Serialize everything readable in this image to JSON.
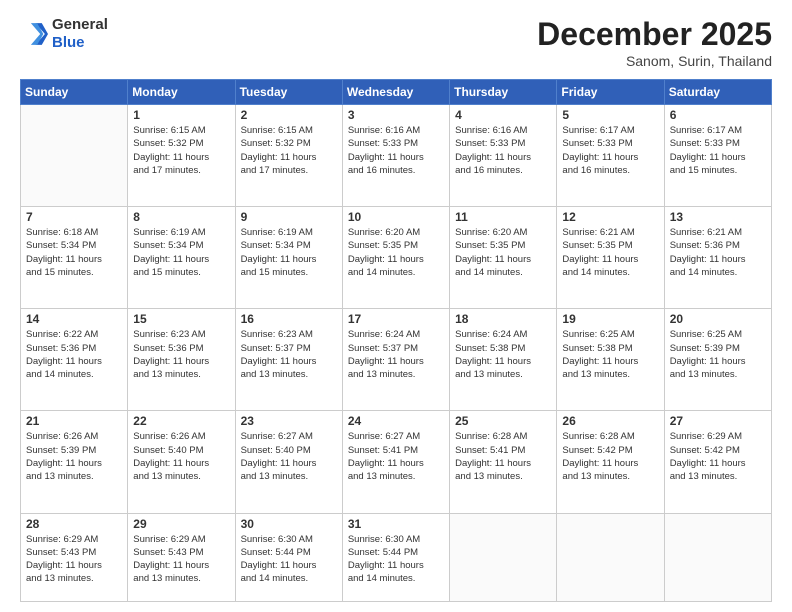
{
  "logo": {
    "line1": "General",
    "line2": "Blue"
  },
  "header": {
    "month": "December 2025",
    "location": "Sanom, Surin, Thailand"
  },
  "weekdays": [
    "Sunday",
    "Monday",
    "Tuesday",
    "Wednesday",
    "Thursday",
    "Friday",
    "Saturday"
  ],
  "weeks": [
    [
      {
        "day": "",
        "info": ""
      },
      {
        "day": "1",
        "info": "Sunrise: 6:15 AM\nSunset: 5:32 PM\nDaylight: 11 hours\nand 17 minutes."
      },
      {
        "day": "2",
        "info": "Sunrise: 6:15 AM\nSunset: 5:32 PM\nDaylight: 11 hours\nand 17 minutes."
      },
      {
        "day": "3",
        "info": "Sunrise: 6:16 AM\nSunset: 5:33 PM\nDaylight: 11 hours\nand 16 minutes."
      },
      {
        "day": "4",
        "info": "Sunrise: 6:16 AM\nSunset: 5:33 PM\nDaylight: 11 hours\nand 16 minutes."
      },
      {
        "day": "5",
        "info": "Sunrise: 6:17 AM\nSunset: 5:33 PM\nDaylight: 11 hours\nand 16 minutes."
      },
      {
        "day": "6",
        "info": "Sunrise: 6:17 AM\nSunset: 5:33 PM\nDaylight: 11 hours\nand 15 minutes."
      }
    ],
    [
      {
        "day": "7",
        "info": "Sunrise: 6:18 AM\nSunset: 5:34 PM\nDaylight: 11 hours\nand 15 minutes."
      },
      {
        "day": "8",
        "info": "Sunrise: 6:19 AM\nSunset: 5:34 PM\nDaylight: 11 hours\nand 15 minutes."
      },
      {
        "day": "9",
        "info": "Sunrise: 6:19 AM\nSunset: 5:34 PM\nDaylight: 11 hours\nand 15 minutes."
      },
      {
        "day": "10",
        "info": "Sunrise: 6:20 AM\nSunset: 5:35 PM\nDaylight: 11 hours\nand 14 minutes."
      },
      {
        "day": "11",
        "info": "Sunrise: 6:20 AM\nSunset: 5:35 PM\nDaylight: 11 hours\nand 14 minutes."
      },
      {
        "day": "12",
        "info": "Sunrise: 6:21 AM\nSunset: 5:35 PM\nDaylight: 11 hours\nand 14 minutes."
      },
      {
        "day": "13",
        "info": "Sunrise: 6:21 AM\nSunset: 5:36 PM\nDaylight: 11 hours\nand 14 minutes."
      }
    ],
    [
      {
        "day": "14",
        "info": "Sunrise: 6:22 AM\nSunset: 5:36 PM\nDaylight: 11 hours\nand 14 minutes."
      },
      {
        "day": "15",
        "info": "Sunrise: 6:23 AM\nSunset: 5:36 PM\nDaylight: 11 hours\nand 13 minutes."
      },
      {
        "day": "16",
        "info": "Sunrise: 6:23 AM\nSunset: 5:37 PM\nDaylight: 11 hours\nand 13 minutes."
      },
      {
        "day": "17",
        "info": "Sunrise: 6:24 AM\nSunset: 5:37 PM\nDaylight: 11 hours\nand 13 minutes."
      },
      {
        "day": "18",
        "info": "Sunrise: 6:24 AM\nSunset: 5:38 PM\nDaylight: 11 hours\nand 13 minutes."
      },
      {
        "day": "19",
        "info": "Sunrise: 6:25 AM\nSunset: 5:38 PM\nDaylight: 11 hours\nand 13 minutes."
      },
      {
        "day": "20",
        "info": "Sunrise: 6:25 AM\nSunset: 5:39 PM\nDaylight: 11 hours\nand 13 minutes."
      }
    ],
    [
      {
        "day": "21",
        "info": "Sunrise: 6:26 AM\nSunset: 5:39 PM\nDaylight: 11 hours\nand 13 minutes."
      },
      {
        "day": "22",
        "info": "Sunrise: 6:26 AM\nSunset: 5:40 PM\nDaylight: 11 hours\nand 13 minutes."
      },
      {
        "day": "23",
        "info": "Sunrise: 6:27 AM\nSunset: 5:40 PM\nDaylight: 11 hours\nand 13 minutes."
      },
      {
        "day": "24",
        "info": "Sunrise: 6:27 AM\nSunset: 5:41 PM\nDaylight: 11 hours\nand 13 minutes."
      },
      {
        "day": "25",
        "info": "Sunrise: 6:28 AM\nSunset: 5:41 PM\nDaylight: 11 hours\nand 13 minutes."
      },
      {
        "day": "26",
        "info": "Sunrise: 6:28 AM\nSunset: 5:42 PM\nDaylight: 11 hours\nand 13 minutes."
      },
      {
        "day": "27",
        "info": "Sunrise: 6:29 AM\nSunset: 5:42 PM\nDaylight: 11 hours\nand 13 minutes."
      }
    ],
    [
      {
        "day": "28",
        "info": "Sunrise: 6:29 AM\nSunset: 5:43 PM\nDaylight: 11 hours\nand 13 minutes."
      },
      {
        "day": "29",
        "info": "Sunrise: 6:29 AM\nSunset: 5:43 PM\nDaylight: 11 hours\nand 13 minutes."
      },
      {
        "day": "30",
        "info": "Sunrise: 6:30 AM\nSunset: 5:44 PM\nDaylight: 11 hours\nand 14 minutes."
      },
      {
        "day": "31",
        "info": "Sunrise: 6:30 AM\nSunset: 5:44 PM\nDaylight: 11 hours\nand 14 minutes."
      },
      {
        "day": "",
        "info": ""
      },
      {
        "day": "",
        "info": ""
      },
      {
        "day": "",
        "info": ""
      }
    ]
  ]
}
